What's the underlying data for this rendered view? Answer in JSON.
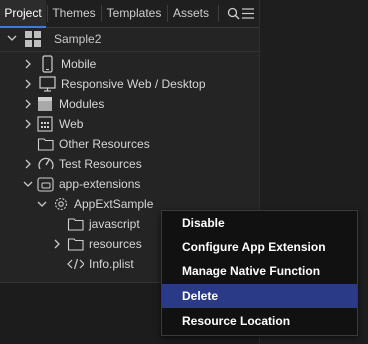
{
  "tabs": [
    {
      "label": "Project"
    },
    {
      "label": "Themes"
    },
    {
      "label": "Templates"
    },
    {
      "label": "Assets"
    }
  ],
  "project": {
    "name": "Sample2"
  },
  "tree": {
    "mobile": "Mobile",
    "responsive": "Responsive Web / Desktop",
    "modules": "Modules",
    "web": "Web",
    "other_resources": "Other Resources",
    "test_resources": "Test Resources",
    "app_extensions": "app-extensions",
    "appextsample": "AppExtSample",
    "javascript": "javascript",
    "resources": "resources",
    "info_plist": "Info.plist"
  },
  "context_menu": {
    "items": [
      {
        "label": "Disable"
      },
      {
        "label": "Configure App Extension"
      },
      {
        "label": "Manage Native Function API(s)"
      },
      {
        "label": "Delete"
      },
      {
        "label": "Resource Location"
      }
    ],
    "highlighted": "Delete"
  },
  "colors": {
    "accent_tab": "#3e7bd8",
    "menu_highlight": "#2b3a87"
  }
}
